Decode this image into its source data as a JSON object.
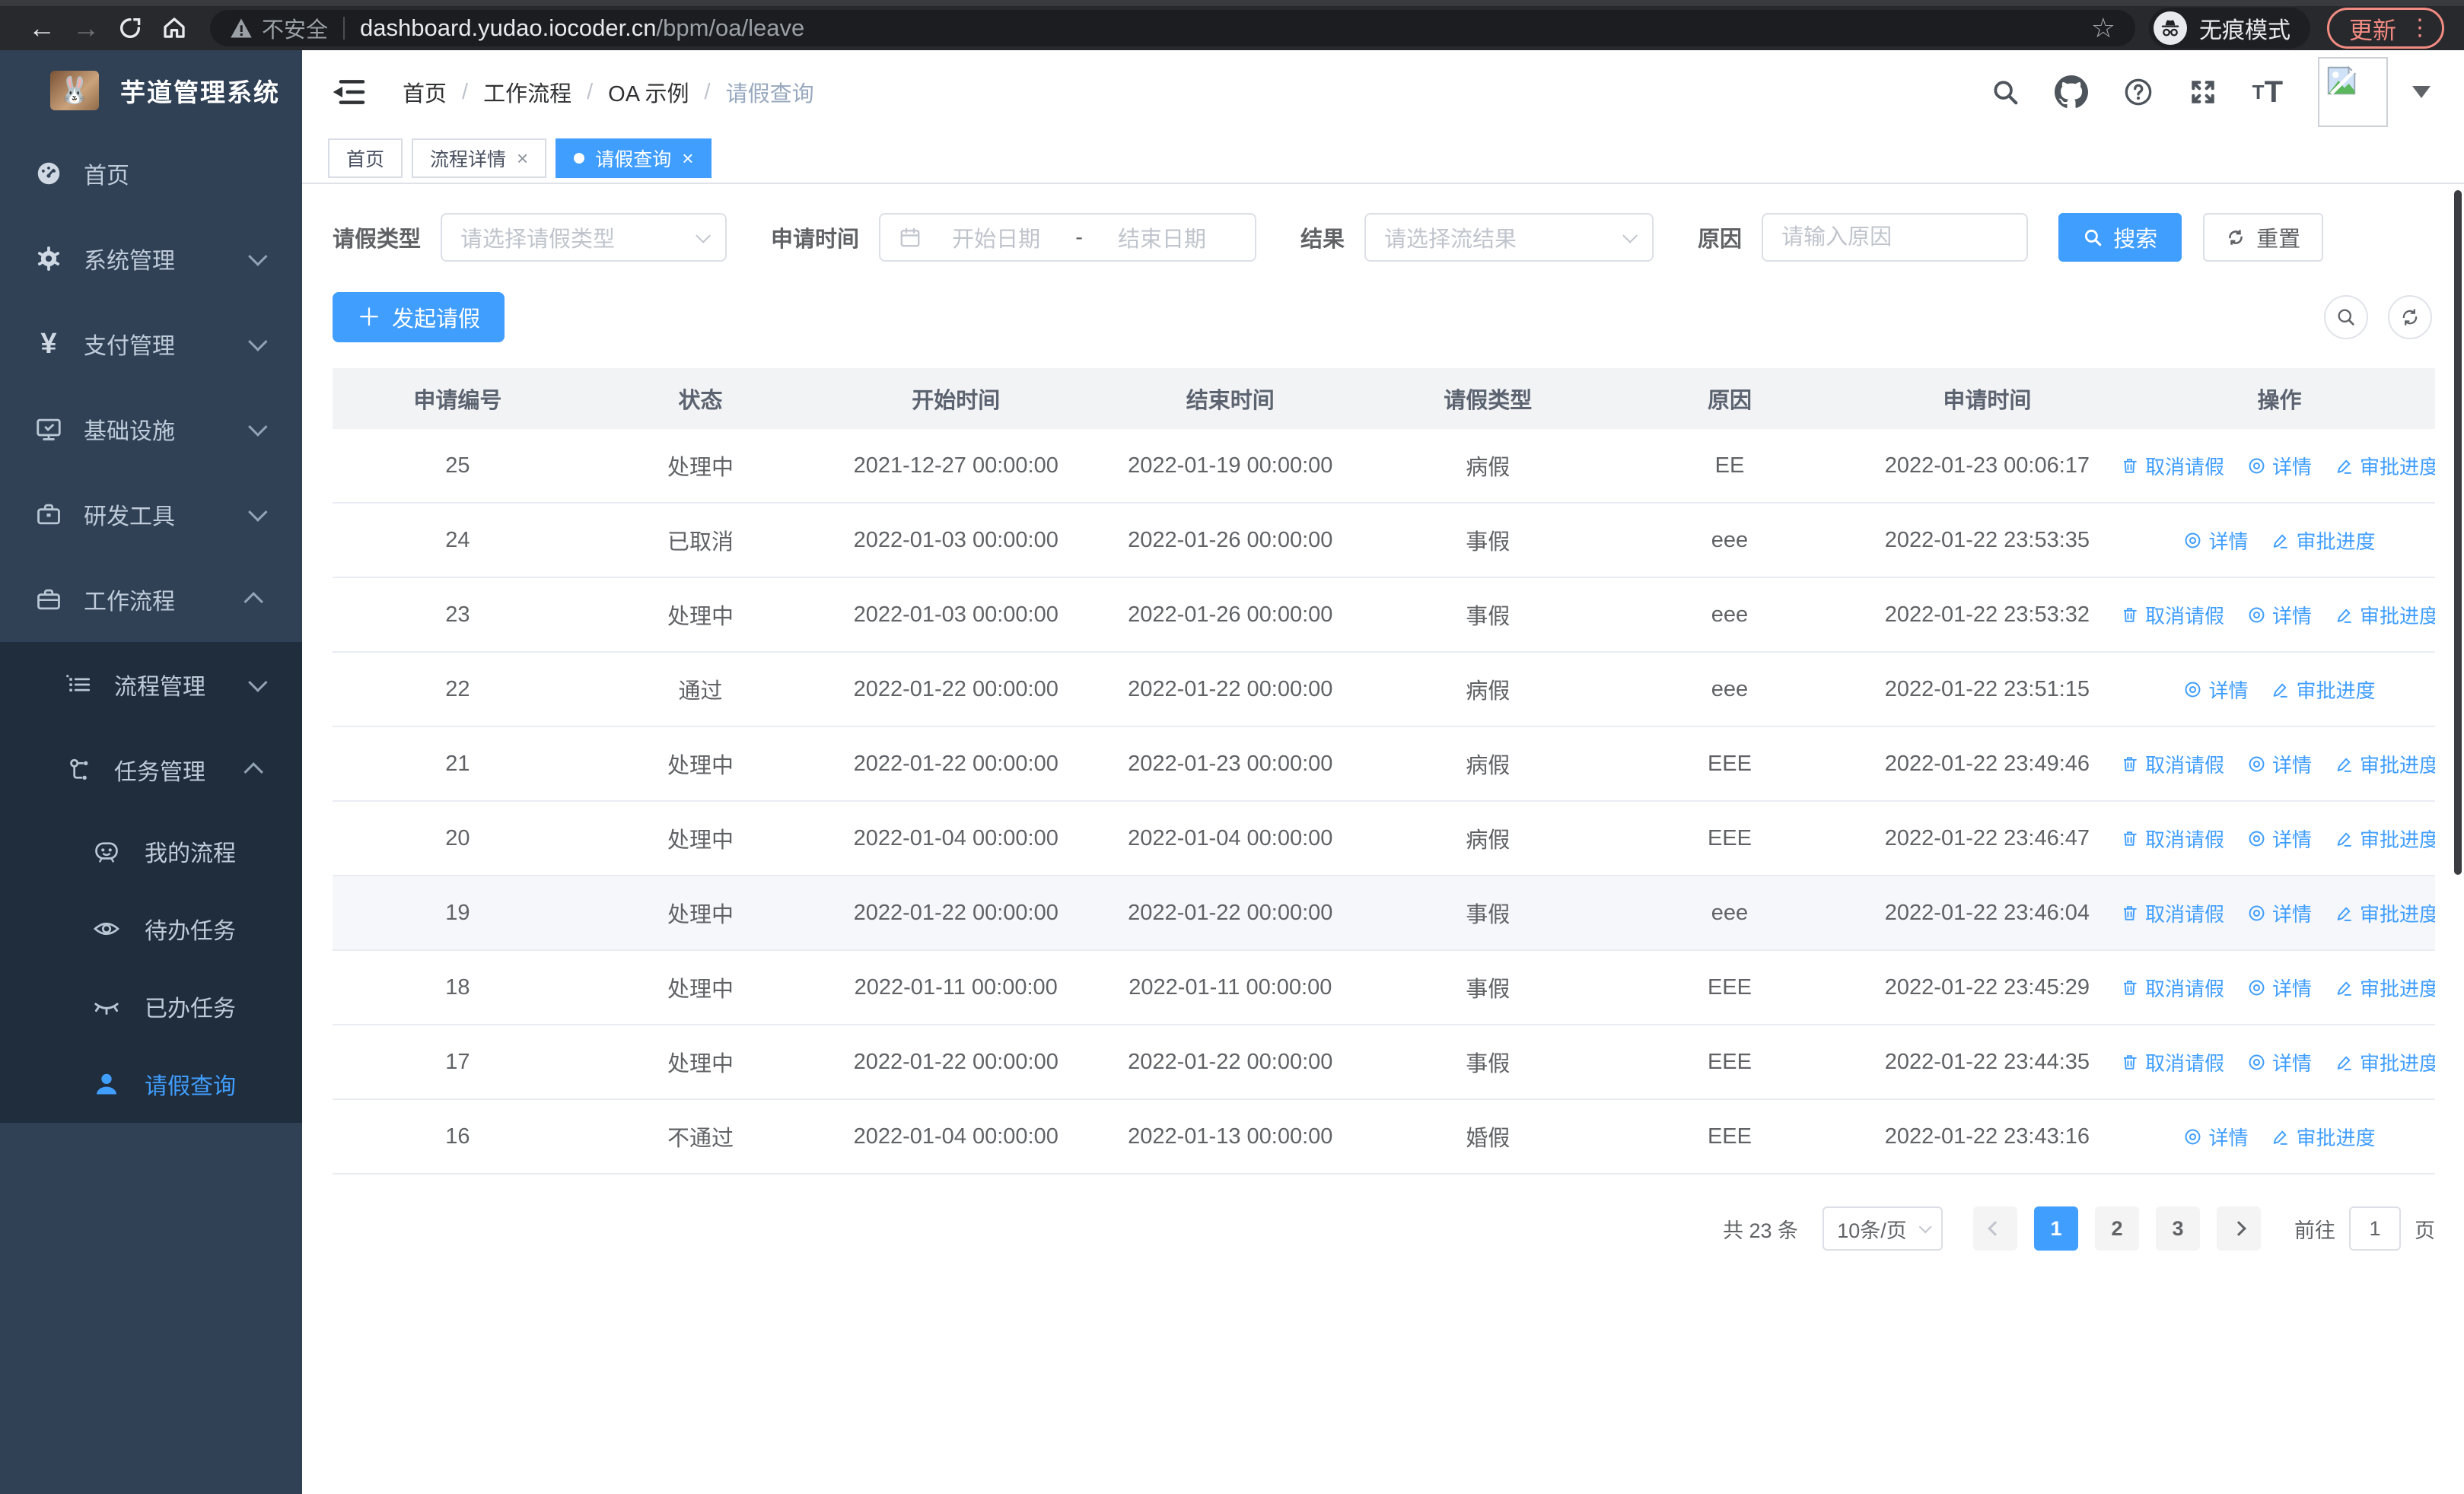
{
  "colors": {
    "primary": "#409eff",
    "sidebar_bg": "#304156",
    "submenu_bg": "#1f2d3d",
    "update_accent": "#f28b82",
    "table_header_bg": "#f2f3f5"
  },
  "browser": {
    "security_label": "不安全",
    "url_domain": "dashboard.yudao.iocoder.cn",
    "url_path": "/bpm/oa/leave",
    "incognito_label": "无痕模式",
    "update_label": "更新"
  },
  "sidebar": {
    "title": "芋道管理系统",
    "items": [
      {
        "name": "sidebar-item-home",
        "label": "首页",
        "icon": "dashboard-icon",
        "level": 1,
        "arrow": null,
        "group": "root",
        "active": false
      },
      {
        "name": "sidebar-item-system-mgmt",
        "label": "系统管理",
        "icon": "gear-icon",
        "level": 1,
        "arrow": "down",
        "group": "root",
        "active": false
      },
      {
        "name": "sidebar-item-payment-mgmt",
        "label": "支付管理",
        "icon": "yen-icon",
        "level": 1,
        "arrow": "down",
        "group": "root",
        "active": false
      },
      {
        "name": "sidebar-item-infrastructure",
        "label": "基础设施",
        "icon": "monitor-icon",
        "level": 1,
        "arrow": "down",
        "group": "root",
        "active": false
      },
      {
        "name": "sidebar-item-dev-tools",
        "label": "研发工具",
        "icon": "toolbox-icon",
        "level": 1,
        "arrow": "down",
        "group": "root",
        "active": false
      },
      {
        "name": "sidebar-item-workflow",
        "label": "工作流程",
        "icon": "suitcase-icon",
        "level": 1,
        "arrow": "up",
        "group": "root",
        "active": false
      },
      {
        "name": "sidebar-item-process-mgmt",
        "label": "流程管理",
        "icon": "list-icon",
        "level": 2,
        "arrow": "down",
        "group": "sub",
        "active": false
      },
      {
        "name": "sidebar-item-task-mgmt",
        "label": "任务管理",
        "icon": "tree-icon",
        "level": 2,
        "arrow": "up",
        "group": "sub",
        "active": false
      },
      {
        "name": "sidebar-item-my-process",
        "label": "我的流程",
        "icon": "chat-face-icon",
        "level": 3,
        "arrow": null,
        "group": "sub",
        "active": false
      },
      {
        "name": "sidebar-item-todo-tasks",
        "label": "待办任务",
        "icon": "eye-icon",
        "level": 3,
        "arrow": null,
        "group": "sub",
        "active": false
      },
      {
        "name": "sidebar-item-done-tasks",
        "label": "已办任务",
        "icon": "eye-closed-icon",
        "level": 3,
        "arrow": null,
        "group": "sub",
        "active": false
      },
      {
        "name": "sidebar-item-leave-query",
        "label": "请假查询",
        "icon": "user-icon",
        "level": 3,
        "arrow": null,
        "group": "sub",
        "active": true
      }
    ]
  },
  "header": {
    "breadcrumb": [
      {
        "label": "首页",
        "current": false
      },
      {
        "label": "工作流程",
        "current": false
      },
      {
        "label": "OA 示例",
        "current": false
      },
      {
        "label": "请假查询",
        "current": true
      }
    ]
  },
  "tabs": [
    {
      "name": "tab-home",
      "label": "首页",
      "closable": false,
      "active": false
    },
    {
      "name": "tab-process-detail",
      "label": "流程详情",
      "closable": true,
      "active": false
    },
    {
      "name": "tab-leave-query",
      "label": "请假查询",
      "closable": true,
      "active": true
    }
  ],
  "filters": {
    "leave_type_label": "请假类型",
    "leave_type_placeholder": "请选择请假类型",
    "apply_time_label": "申请时间",
    "start_date_placeholder": "开始日期",
    "range_separator": "-",
    "end_date_placeholder": "结束日期",
    "result_label": "结果",
    "result_placeholder": "请选择流结果",
    "reason_label": "原因",
    "reason_placeholder": "请输入原因",
    "search_label": "搜索",
    "reset_label": "重置"
  },
  "actions_bar": {
    "create_label": "发起请假"
  },
  "table": {
    "columns": [
      "申请编号",
      "状态",
      "开始时间",
      "结束时间",
      "请假类型",
      "原因",
      "申请时间",
      "操作"
    ],
    "action_labels": {
      "cancel": "取消请假",
      "detail": "详情",
      "progress": "审批进度"
    },
    "rows": [
      {
        "id": "25",
        "status": "处理中",
        "start": "2021-12-27 00:00:00",
        "end": "2022-01-19 00:00:00",
        "type": "病假",
        "reason": "EE",
        "apply_time": "2022-01-23 00:06:17",
        "actions": [
          "cancel",
          "detail",
          "progress"
        ],
        "highlight": false
      },
      {
        "id": "24",
        "status": "已取消",
        "start": "2022-01-03 00:00:00",
        "end": "2022-01-26 00:00:00",
        "type": "事假",
        "reason": "eee",
        "apply_time": "2022-01-22 23:53:35",
        "actions": [
          "detail",
          "progress"
        ],
        "highlight": false
      },
      {
        "id": "23",
        "status": "处理中",
        "start": "2022-01-03 00:00:00",
        "end": "2022-01-26 00:00:00",
        "type": "事假",
        "reason": "eee",
        "apply_time": "2022-01-22 23:53:32",
        "actions": [
          "cancel",
          "detail",
          "progress"
        ],
        "highlight": false
      },
      {
        "id": "22",
        "status": "通过",
        "start": "2022-01-22 00:00:00",
        "end": "2022-01-22 00:00:00",
        "type": "病假",
        "reason": "eee",
        "apply_time": "2022-01-22 23:51:15",
        "actions": [
          "detail",
          "progress"
        ],
        "highlight": false
      },
      {
        "id": "21",
        "status": "处理中",
        "start": "2022-01-22 00:00:00",
        "end": "2022-01-23 00:00:00",
        "type": "病假",
        "reason": "EEE",
        "apply_time": "2022-01-22 23:49:46",
        "actions": [
          "cancel",
          "detail",
          "progress"
        ],
        "highlight": false
      },
      {
        "id": "20",
        "status": "处理中",
        "start": "2022-01-04 00:00:00",
        "end": "2022-01-04 00:00:00",
        "type": "病假",
        "reason": "EEE",
        "apply_time": "2022-01-22 23:46:47",
        "actions": [
          "cancel",
          "detail",
          "progress"
        ],
        "highlight": false
      },
      {
        "id": "19",
        "status": "处理中",
        "start": "2022-01-22 00:00:00",
        "end": "2022-01-22 00:00:00",
        "type": "事假",
        "reason": "eee",
        "apply_time": "2022-01-22 23:46:04",
        "actions": [
          "cancel",
          "detail",
          "progress"
        ],
        "highlight": true
      },
      {
        "id": "18",
        "status": "处理中",
        "start": "2022-01-11 00:00:00",
        "end": "2022-01-11 00:00:00",
        "type": "事假",
        "reason": "EEE",
        "apply_time": "2022-01-22 23:45:29",
        "actions": [
          "cancel",
          "detail",
          "progress"
        ],
        "highlight": false
      },
      {
        "id": "17",
        "status": "处理中",
        "start": "2022-01-22 00:00:00",
        "end": "2022-01-22 00:00:00",
        "type": "事假",
        "reason": "EEE",
        "apply_time": "2022-01-22 23:44:35",
        "actions": [
          "cancel",
          "detail",
          "progress"
        ],
        "highlight": false
      },
      {
        "id": "16",
        "status": "不通过",
        "start": "2022-01-04 00:00:00",
        "end": "2022-01-13 00:00:00",
        "type": "婚假",
        "reason": "EEE",
        "apply_time": "2022-01-22 23:43:16",
        "actions": [
          "detail",
          "progress"
        ],
        "highlight": false
      }
    ]
  },
  "pagination": {
    "total_text": "共 23 条",
    "page_size_value": "10条/页",
    "pages": [
      "1",
      "2",
      "3"
    ],
    "active_page": "1",
    "goto_label": "前往",
    "goto_value": "1",
    "unit_label": "页"
  }
}
